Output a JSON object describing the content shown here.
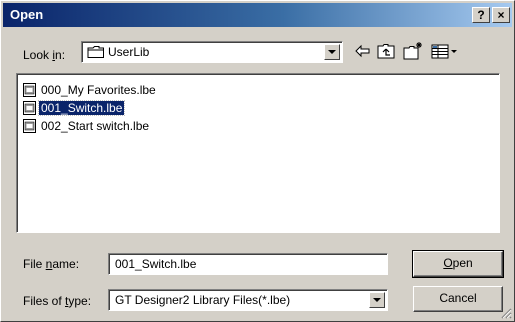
{
  "window": {
    "title": "Open",
    "help_label": "?",
    "close_label": "×"
  },
  "look_in": {
    "label_pre": "Look ",
    "label_accel": "i",
    "label_post": "n:",
    "value": "UserLib",
    "icon": "folder-icon"
  },
  "toolbar": {
    "icons": [
      "back-arrow-icon",
      "up-folder-icon",
      "new-folder-icon",
      "view-menu-icon"
    ]
  },
  "files": [
    {
      "name": "000_My Favorites.lbe",
      "selected": false
    },
    {
      "name": "001_Switch.lbe",
      "selected": true
    },
    {
      "name": "002_Start switch.lbe",
      "selected": false
    }
  ],
  "file_name": {
    "label_pre": "File ",
    "label_accel": "n",
    "label_post": "ame:",
    "value": "001_Switch.lbe"
  },
  "file_type": {
    "label_pre": "Files of ",
    "label_accel": "t",
    "label_post": "ype:",
    "value": "GT Designer2 Library Files(*.lbe)"
  },
  "buttons": {
    "open_accel": "O",
    "open_rest": "pen",
    "cancel": "Cancel"
  },
  "colors": {
    "selection": "#0a246a",
    "face": "#d4d0c8"
  }
}
